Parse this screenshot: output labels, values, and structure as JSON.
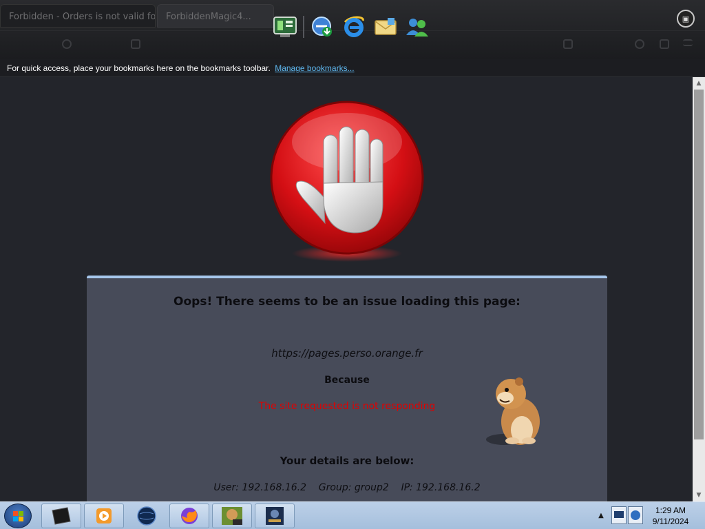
{
  "browser": {
    "tabs": [
      {
        "title": "Forbidden - Orders is not valid for..."
      },
      {
        "title": "ForbiddenMagic4..."
      }
    ],
    "bookmarks_bar": {
      "message": "For quick access, place your bookmarks here on the bookmarks toolbar.",
      "manage_link": "Manage bookmarks..."
    }
  },
  "page": {
    "title": "Oops! There seems to be an issue loading this page:",
    "url": "https://pages.perso.orange.fr",
    "because_label": "Because",
    "reason": "The site requested is not responding",
    "details_title": "Your details are below:",
    "details": {
      "user_label": "User:",
      "user": "192.168.16.2",
      "group_label": "Group:",
      "group": "group2",
      "ip_label": "IP:",
      "ip": "192.168.16.2"
    }
  },
  "taskbar": {
    "tasks": [
      {
        "icon": "monitor-app-icon"
      },
      {
        "icon": "media-player-icon"
      },
      {
        "icon": "globe-icon"
      },
      {
        "icon": "firefox-icon"
      },
      {
        "icon": "hamster-box-icon"
      },
      {
        "icon": "game-icon"
      }
    ],
    "clock": {
      "time": "1:29 AM",
      "date": "9/11/2024"
    }
  },
  "colors": {
    "panel_bg": "#474b59",
    "panel_border": "#a6c7ec",
    "reason_red": "#e10000",
    "link_blue": "#5fb8f0",
    "taskbar_blue": "#a5bfdc"
  }
}
